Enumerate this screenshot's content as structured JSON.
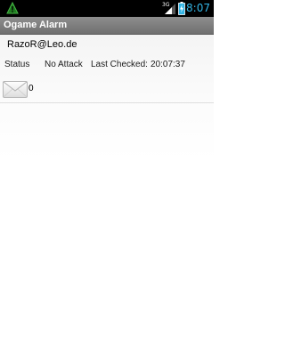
{
  "status_bar": {
    "time": "8:07",
    "network_type": "3G",
    "accent_color": "#33b5e5",
    "icons": [
      "warning-icon",
      "signal-icon",
      "battery-charging-icon"
    ]
  },
  "app": {
    "title": "Ogame Alarm"
  },
  "account": {
    "name": "RazoR@Leo.de"
  },
  "status": {
    "label": "Status",
    "value": "No Attack",
    "last_checked_label": "Last Checked:",
    "last_checked_time": "20:07:37"
  },
  "messages": {
    "icon": "envelope-icon",
    "count": "0"
  }
}
